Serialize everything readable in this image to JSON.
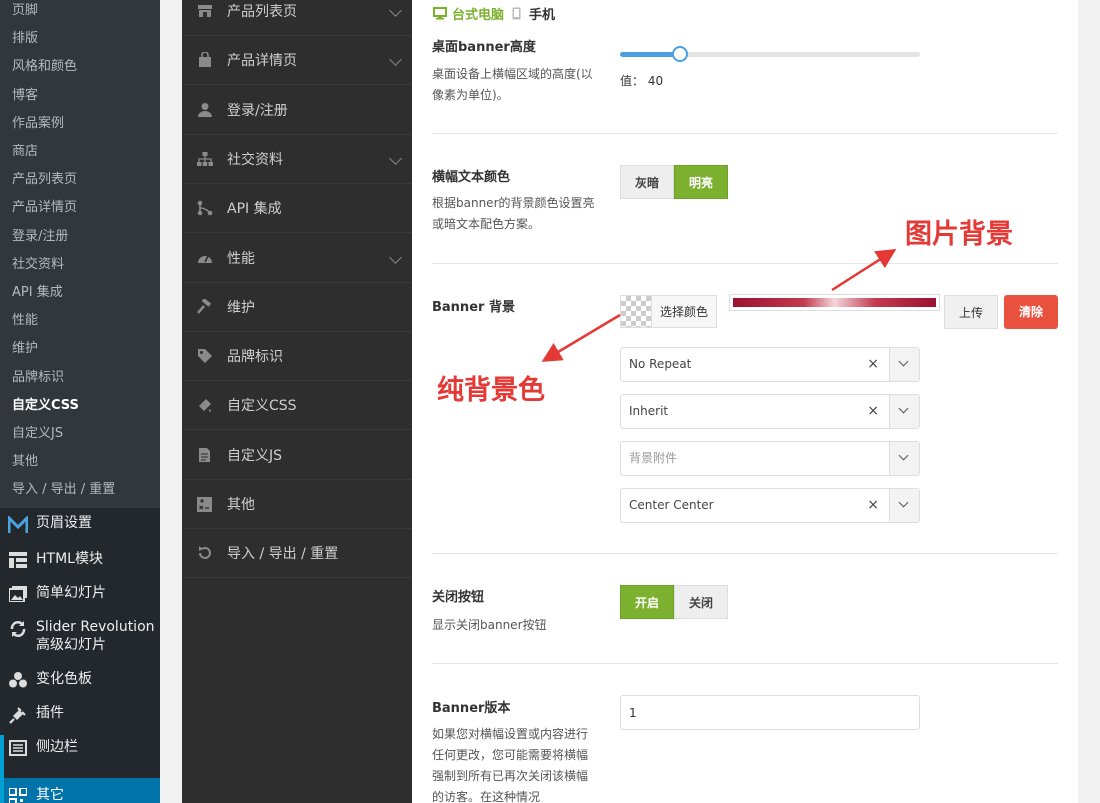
{
  "wp_submenu": [
    "页脚",
    "排版",
    "风格和颜色",
    "博客",
    "作品案例",
    "商店",
    "产品列表页",
    "产品详情页",
    "登录/注册",
    "社交资料",
    "API 集成",
    "性能",
    "维护",
    "品牌标识",
    "自定义CSS",
    "自定义JS",
    "其他",
    "导入 / 导出 / 重置"
  ],
  "wp_submenu_active": "自定义CSS",
  "wp_menu": [
    {
      "label": "页眉设置",
      "icon": "m-logo-icon"
    },
    {
      "label": "HTML模块",
      "icon": "grid-icon"
    },
    {
      "label": "简单幻灯片",
      "icon": "images-icon"
    },
    {
      "label": "Slider Revolution",
      "label2": "高级幻灯片",
      "icon": "refresh-icon"
    },
    {
      "label": "变化色板",
      "icon": "color-swatch-icon"
    },
    {
      "label": "插件",
      "icon": "plugin-icon"
    },
    {
      "label": "侧边栏",
      "icon": "sidebar-icon"
    },
    {
      "label": "其它",
      "icon": "qr-grid-icon"
    }
  ],
  "options_nav": [
    {
      "label": "产品列表页",
      "icon": "store-icon",
      "chevron": true
    },
    {
      "label": "产品详情页",
      "icon": "bag-icon",
      "chevron": true
    },
    {
      "label": "登录/注册",
      "icon": "user-icon",
      "chevron": false
    },
    {
      "label": "社交资料",
      "icon": "sitemap-icon",
      "chevron": true
    },
    {
      "label": "API 集成",
      "icon": "api-icon",
      "chevron": false
    },
    {
      "label": "性能",
      "icon": "dashboard-icon",
      "chevron": true
    },
    {
      "label": "维护",
      "icon": "hammer-icon",
      "chevron": false
    },
    {
      "label": "品牌标识",
      "icon": "tag-icon",
      "chevron": false
    },
    {
      "label": "自定义CSS",
      "icon": "paint-icon",
      "chevron": false
    },
    {
      "label": "自定义JS",
      "icon": "file-icon",
      "chevron": false
    },
    {
      "label": "其他",
      "icon": "plusminus-icon",
      "chevron": false
    },
    {
      "label": "导入 / 导出 / 重置",
      "icon": "reset-icon",
      "chevron": false
    }
  ],
  "devices": {
    "desktop": "台式电脑",
    "mobile": "手机"
  },
  "banner_height": {
    "title": "桌面banner高度",
    "desc": "桌面设备上横幅区域的高度(以像素为单位)。",
    "value_label": "值：",
    "value": "40",
    "fraction": 0.2
  },
  "banner_text_color": {
    "title": "横幅文本颜色",
    "desc": "根据banner的背景颜色设置亮或暗文本配色方案。",
    "options": [
      "灰暗",
      "明亮"
    ],
    "selected": "明亮"
  },
  "banner_background": {
    "title": "Banner 背景",
    "pick_color": "选择颜色",
    "upload": "上传",
    "clear": "清除",
    "repeat": "No Repeat",
    "size": "Inherit",
    "attachment_placeholder": "背景附件",
    "position": "Center Center",
    "clear_x": "×"
  },
  "close_button": {
    "title": "关闭按钮",
    "desc": "显示关闭banner按钮",
    "options": [
      "开启",
      "关闭"
    ],
    "selected": "开启"
  },
  "banner_version": {
    "title": "Banner版本",
    "desc": "如果您对横幅设置或内容进行任何更改，您可能需要将横幅强制到所有已再次关闭该横幅的访客。在这种情况",
    "value": "1"
  },
  "annotations": {
    "image_bg": "图片背景",
    "solid_bg": "纯背景色"
  },
  "colors": {
    "accent_green": "#7bb12e",
    "clear_red": "#e9513f",
    "annotation_red": "#e53935",
    "wp_blue": "#0073aa"
  }
}
